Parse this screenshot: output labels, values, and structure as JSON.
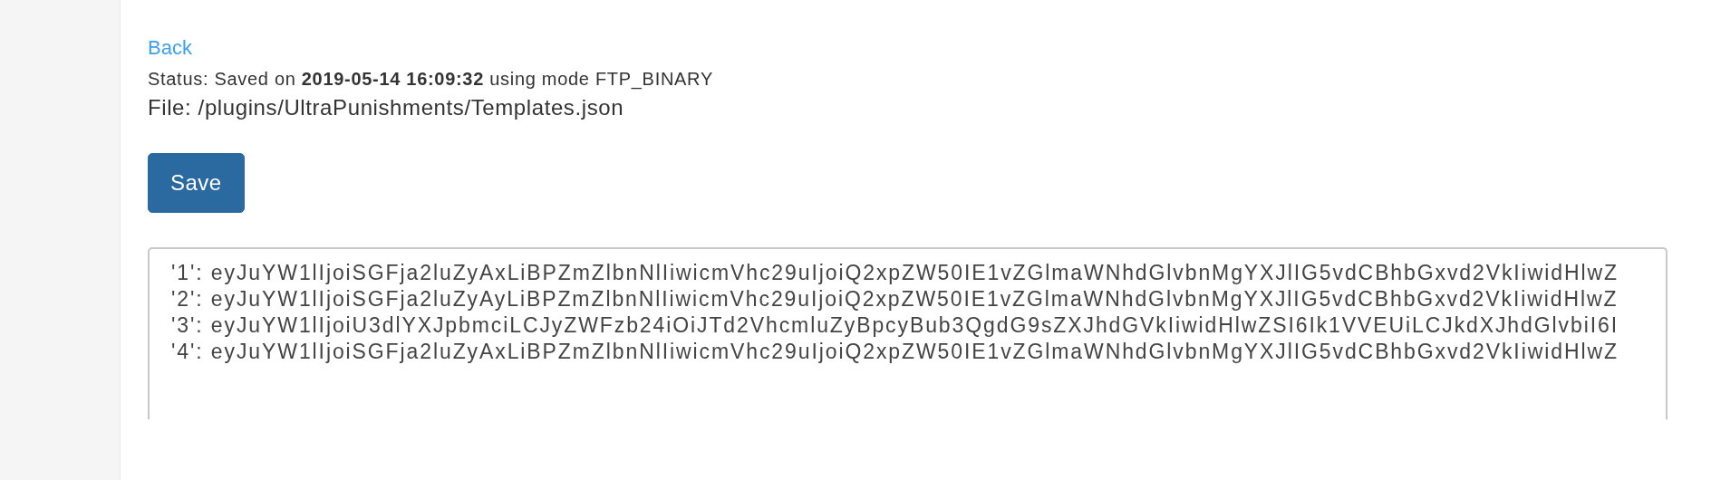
{
  "back_link": "Back",
  "status": "Status: Saved on **2019-05-14 16:09:32** using mode FTP_BINARY",
  "file": "File: /plugins/UltraPunishments/Templates.json",
  "save_button": "Save",
  "editor": {
    "lines": [
      "'1': eyJuYW1lIjoiSGFja2luZyAxLiBPZmZlbnNlIiwicmVhc29uIjoiQ2xpZW50IE1vZGlmaWNhdGlvbnMgYXJlIG5vdCBhbGxvd2VkIiwidHlwZ",
      "'2': eyJuYW1lIjoiSGFja2luZyAyLiBPZmZlbnNlIiwicmVhc29uIjoiQ2xpZW50IE1vZGlmaWNhdGlvbnMgYXJlIG5vdCBhbGxvd2VkIiwidHlwZ",
      "'3': eyJuYW1lIjoiU3dlYXJpbmciLCJyZWFzb24iOiJTd2VhcmluZyBpcyBub3QgdG9sZXJhdGVkIiwidHlwZSI6Ik1VVEUiLCJkdXJhdGlvbiI6I",
      "'4': eyJuYW1lIjoiSGFja2luZyAxLiBPZmZlbnNlIiwicmVhc29uIjoiQ2xpZW50IE1vZGlmaWNhdGlvbnMgYXJlIG5vdCBhbGxvd2VkIiwidHlwZ"
    ]
  }
}
